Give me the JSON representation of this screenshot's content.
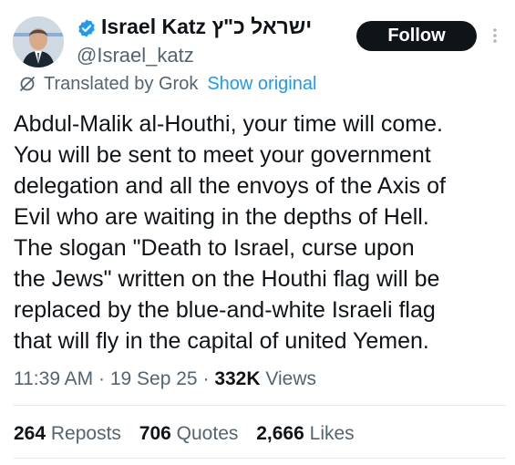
{
  "author": {
    "display_name": "Israel Katz ישראל כ\"ץ",
    "handle": "@Israel_katz",
    "verified": true
  },
  "follow_label": "Follow",
  "translation": {
    "note": "Translated by Grok",
    "show_original": "Show original"
  },
  "tweet": {
    "lines": [
      "Abdul-Malik al-Houthi, your time will come.",
      "You will be sent to meet your government",
      "delegation and all the envoys of the Axis of",
      "Evil who are waiting in the depths of Hell.",
      "The slogan \"Death to Israel, curse upon",
      "the Jews\" written on the Houthi flag will be",
      "replaced by the blue-and-white Israeli flag",
      "that will fly in the capital of united Yemen."
    ]
  },
  "meta": {
    "time": "11:39 AM",
    "sep1": "·",
    "date": "19 Sep 25",
    "sep2": "·",
    "views_count": "332K",
    "views_label": "Views"
  },
  "stats": {
    "reposts_count": "264",
    "reposts_label": "Reposts",
    "quotes_count": "706",
    "quotes_label": "Quotes",
    "likes_count": "2,666",
    "likes_label": "Likes"
  },
  "colors": {
    "verified_badge": "#1d9bf0",
    "link": "#1d9bf0",
    "secondary_text": "#536471",
    "follow_button": "#0f1419"
  },
  "icons": [
    "verified-badge-icon",
    "translate-icon",
    "more-options-icon"
  ]
}
